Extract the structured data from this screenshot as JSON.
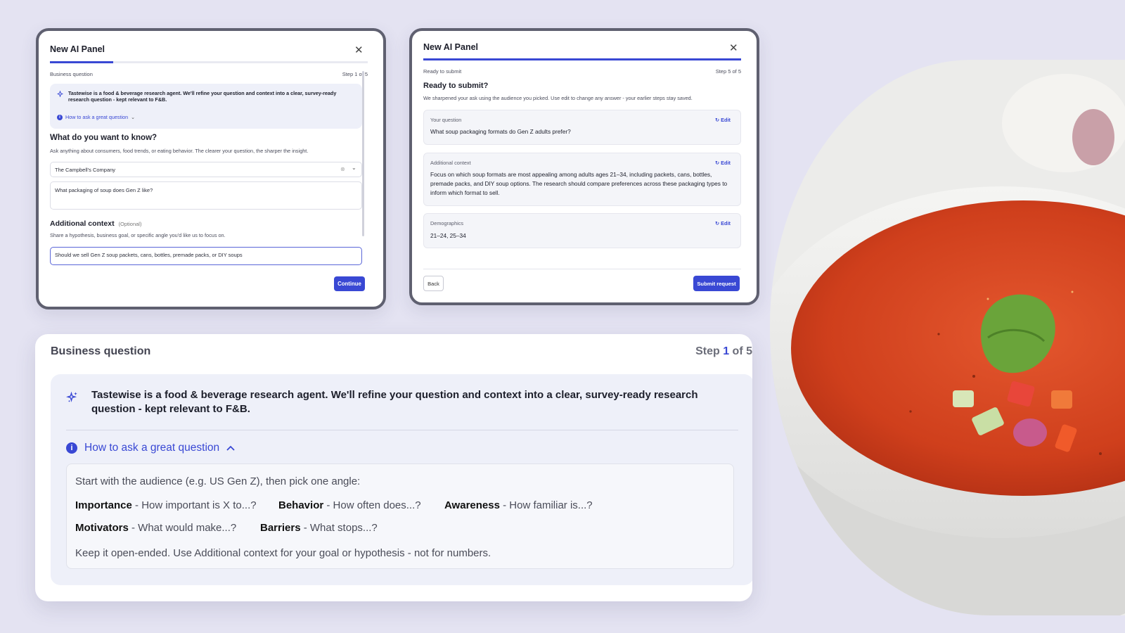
{
  "panel_step1": {
    "title": "New AI Panel",
    "section_label": "Business question",
    "step": "Step 1 of 5",
    "progress": 0.2,
    "intro": "Tastewise is a food & beverage research agent. We'll refine your question and context into a clear, survey-ready research question - kept relevant to F&B.",
    "howto_label": "How to ask a great question",
    "question_heading": "What do you want to know?",
    "question_help": "Ask anything about consumers, food trends, or eating behavior. The clearer your question, the sharper the insight.",
    "company_value": "The Campbell's Company",
    "question_value": "What packaging of soup does Gen Z like?",
    "context_heading": "Additional context",
    "context_optional": "(Optional)",
    "context_help": "Share a hypothesis, business goal, or specific angle you'd like us to focus on.",
    "context_value": "Should we sell Gen Z soup packets, cans, bottles, premade packs, or DIY soups",
    "continue_label": "Continue"
  },
  "panel_step5": {
    "title": "New AI Panel",
    "section_label": "Ready to submit",
    "step": "Step 5 of 5",
    "progress": 1.0,
    "heading": "Ready to submit?",
    "subtext": "We sharpened your ask using the audience you picked. Use edit to change any answer - your earlier steps stay saved.",
    "edit_label": "Edit",
    "cards": [
      {
        "label": "Your question",
        "value": "What soup packaging formats do Gen Z adults prefer?"
      },
      {
        "label": "Additional context",
        "value": "Focus on which soup formats are most appealing among adults ages 21–34, including packets, cans, bottles, premade packs, and DIY soup options. The research should compare preferences across these packaging types to inform which format to sell."
      },
      {
        "label": "Demographics",
        "value": "21–24, 25–34"
      }
    ],
    "back_label": "Back",
    "submit_label": "Submit request"
  },
  "zoom": {
    "section_label": "Business question",
    "step_prefix": "Step ",
    "step_current": "1",
    "step_suffix": " of 5",
    "intro": "Tastewise is a food & beverage research agent. We'll refine your question and context into a clear, survey-ready research question - kept relevant to F&B.",
    "howto_label": "How to ask a great question",
    "start": "Start with the audience (e.g. US Gen Z), then pick one angle:",
    "angles": [
      {
        "name": "Importance",
        "prompt": " - How important is X to...?"
      },
      {
        "name": "Behavior",
        "prompt": " - How often does...?"
      },
      {
        "name": "Awareness",
        "prompt": " - How familiar is...?"
      },
      {
        "name": "Motivators",
        "prompt": " - What would make...?"
      },
      {
        "name": "Barriers",
        "prompt": " - What stops...?"
      }
    ],
    "tip": "Keep it open-ended. Use Additional context for your goal or hypothesis - not for numbers."
  },
  "icons": {
    "sparkle": "sparkle-icon",
    "close": "close-icon",
    "info": "info-icon",
    "chevron_down": "chevron-down-icon",
    "chevron_up": "chevron-up-icon",
    "clear": "clear-icon",
    "edit": "edit-icon"
  },
  "colors": {
    "accent": "#3948d4",
    "background": "#e4e3f2",
    "info_box": "#eef0f9"
  }
}
